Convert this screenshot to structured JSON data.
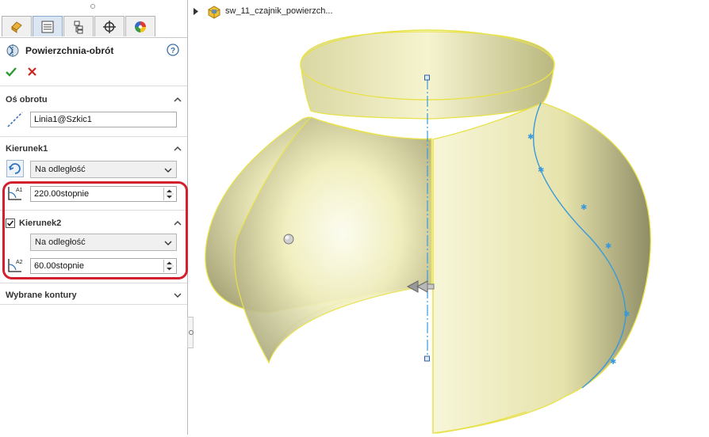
{
  "property_manager": {
    "title": "Powierzchnia-obrót",
    "tabs": [
      "feature-manager",
      "property-manager",
      "configuration-manager",
      "dimxpert-manager",
      "display-manager"
    ],
    "ok_icon": "checkmark-icon",
    "cancel_icon": "x-icon",
    "help_icon": "help-icon",
    "sections": {
      "axis": {
        "title": "Oś obrotu",
        "value": "Linia1@Szkic1"
      },
      "direction1": {
        "title": "Kierunek1",
        "type_selected": "Na odległość",
        "angle": "220.00stopnie"
      },
      "direction2": {
        "title": "Kierunek2",
        "checked": true,
        "type_selected": "Na odległość",
        "angle": "60.00stopnie"
      },
      "contours": {
        "title": "Wybrane kontury"
      }
    }
  },
  "tree": {
    "label": "sw_11_czajnik_powierzch..."
  },
  "colors": {
    "highlight_red": "#d3202f",
    "surface_yellow": "#f3f0b6",
    "edge_yellow": "#e8e24a",
    "sketch_blue": "#3a9ad9"
  }
}
